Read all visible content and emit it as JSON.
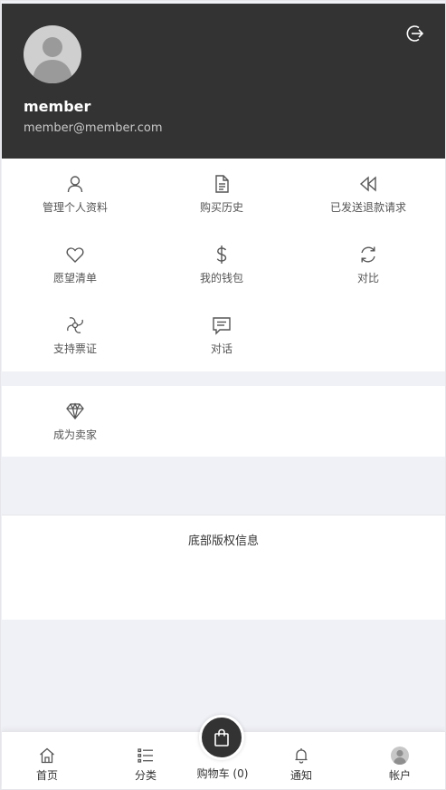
{
  "profile": {
    "username": "member",
    "email": "member@member.com",
    "avatar_icon": "user-silhouette-icon",
    "logout_icon": "logout-icon"
  },
  "menu": {
    "items": [
      {
        "label": "管理个人资料",
        "icon": "user-icon"
      },
      {
        "label": "购买历史",
        "icon": "document-icon"
      },
      {
        "label": "已发送退款请求",
        "icon": "rewind-icon"
      },
      {
        "label": "愿望清单",
        "icon": "heart-icon"
      },
      {
        "label": "我的钱包",
        "icon": "dollar-icon"
      },
      {
        "label": "对比",
        "icon": "refresh-icon"
      },
      {
        "label": "支持票证",
        "icon": "support-icon"
      },
      {
        "label": "对话",
        "icon": "chat-icon"
      }
    ]
  },
  "seller": {
    "label": "成为卖家",
    "icon": "diamond-icon"
  },
  "footer": {
    "copyright": "底部版权信息"
  },
  "bottom_nav": {
    "home": "首页",
    "categories": "分类",
    "cart": "购物车 (0)",
    "notifications": "通知",
    "account": "帐户"
  },
  "colors": {
    "header_bg": "#333333",
    "page_bg": "#f0f1f6",
    "icon_stroke": "#555555"
  }
}
